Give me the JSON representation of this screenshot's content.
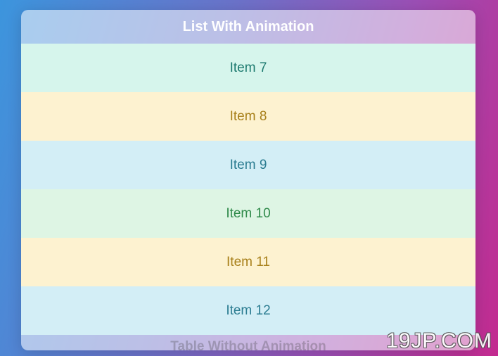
{
  "header": {
    "title": "List With Animation"
  },
  "list": {
    "items": [
      {
        "label": "Item 7",
        "variant": "teal"
      },
      {
        "label": "Item 8",
        "variant": "yellow"
      },
      {
        "label": "Item 9",
        "variant": "blue"
      },
      {
        "label": "Item 10",
        "variant": "green"
      },
      {
        "label": "Item 11",
        "variant": "yellow"
      },
      {
        "label": "Item 12",
        "variant": "blue"
      }
    ]
  },
  "second_header": {
    "title": "Table Without Animation"
  },
  "watermark": "19JP.COM"
}
